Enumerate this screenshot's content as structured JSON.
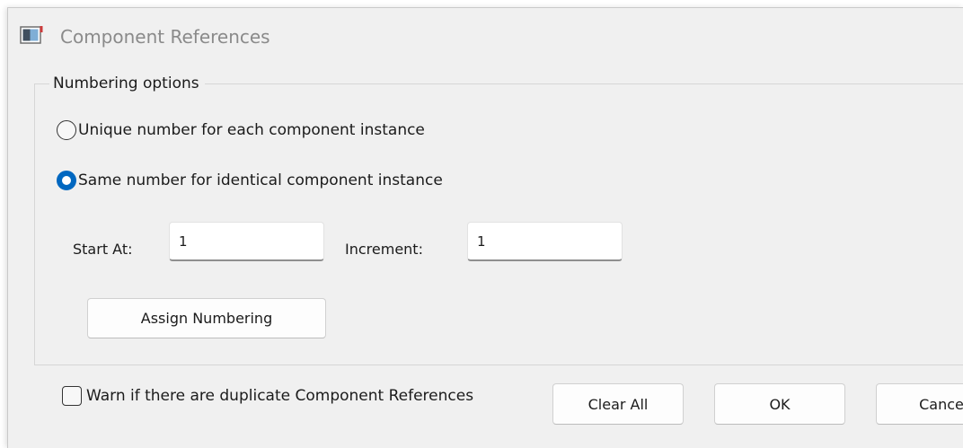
{
  "window": {
    "title": "Component References",
    "icon": "app-window-icon"
  },
  "numbering": {
    "group_label": "Numbering options",
    "option_unique": "Unique number for each component instance",
    "option_same": "Same number for identical component instance",
    "selected": "same",
    "start_at_label": "Start At:",
    "start_at_value": "1",
    "increment_label": "Increment:",
    "increment_value": "1",
    "assign_button": "Assign Numbering"
  },
  "footer": {
    "warn_label": "Warn if there are duplicate Component References",
    "warn_checked": false,
    "clear_all_button": "Clear All",
    "ok_button": "OK",
    "cancel_button": "Cance"
  },
  "colors": {
    "accent": "#0067c0",
    "window_bg": "#f0f0f0",
    "title_text": "#8a8a8a"
  }
}
